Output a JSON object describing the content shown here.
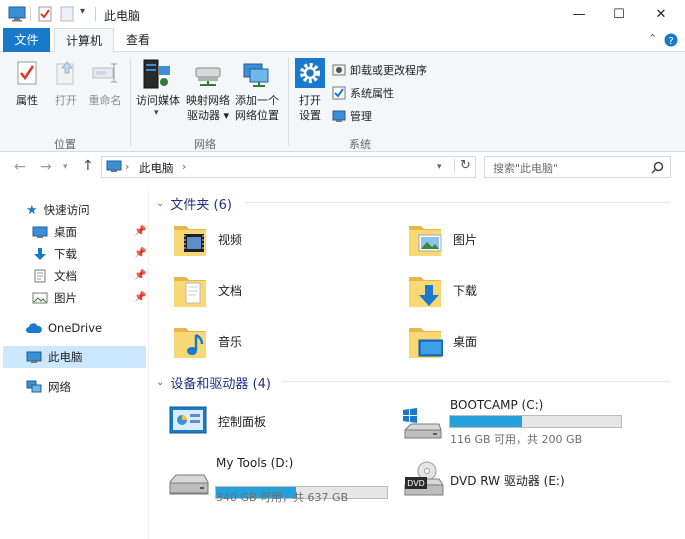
{
  "window": {
    "title": "此电脑",
    "minimize": "—",
    "maximize": "☐",
    "close": "✕"
  },
  "tabs": [
    {
      "label": "文件"
    },
    {
      "label": "计算机"
    },
    {
      "label": "查看"
    }
  ],
  "ribbon": {
    "location": {
      "label": "位置",
      "properties": "属性",
      "open": "打开",
      "rename": "重命名"
    },
    "network": {
      "label": "网络",
      "access_media_1": "访问媒体",
      "map_drive_1": "映射网络",
      "map_drive_2": "驱动器 ▾",
      "add_location_1": "添加一个",
      "add_location_2": "网络位置"
    },
    "system": {
      "label": "系统",
      "open_settings_1": "打开",
      "open_settings_2": "设置",
      "uninstall": "卸载或更改程序",
      "sys_props": "系统属性",
      "manage": "管理"
    }
  },
  "address": {
    "path_label": "此电脑",
    "sep": "›",
    "search_placeholder": "搜索\"此电脑\""
  },
  "nav": {
    "quick_access": "快速访问",
    "desktop": "桌面",
    "downloads": "下载",
    "documents": "文档",
    "pictures": "图片",
    "onedrive": "OneDrive",
    "this_pc": "此电脑",
    "network": "网络"
  },
  "folders": {
    "header": "文件夹 (6)",
    "items": [
      "视频",
      "图片",
      "文档",
      "下载",
      "音乐",
      "桌面"
    ]
  },
  "devices": {
    "header": "设备和驱动器 (4)",
    "control_panel": "控制面板",
    "drives": [
      {
        "name": "BOOTCAMP (C:)",
        "info": "116 GB 可用，共 200 GB",
        "used_fraction": 0.42
      },
      {
        "name": "My Tools (D:)",
        "info": "340 GB 可用，共 637 GB",
        "used_fraction": 0.47
      }
    ],
    "dvd": "DVD RW 驱动器 (E:)",
    "dvd_badge": "DVD"
  },
  "colors": {
    "accent": "#1979ca",
    "bar_fill": "#26a0da",
    "folder": "#f8d775"
  }
}
